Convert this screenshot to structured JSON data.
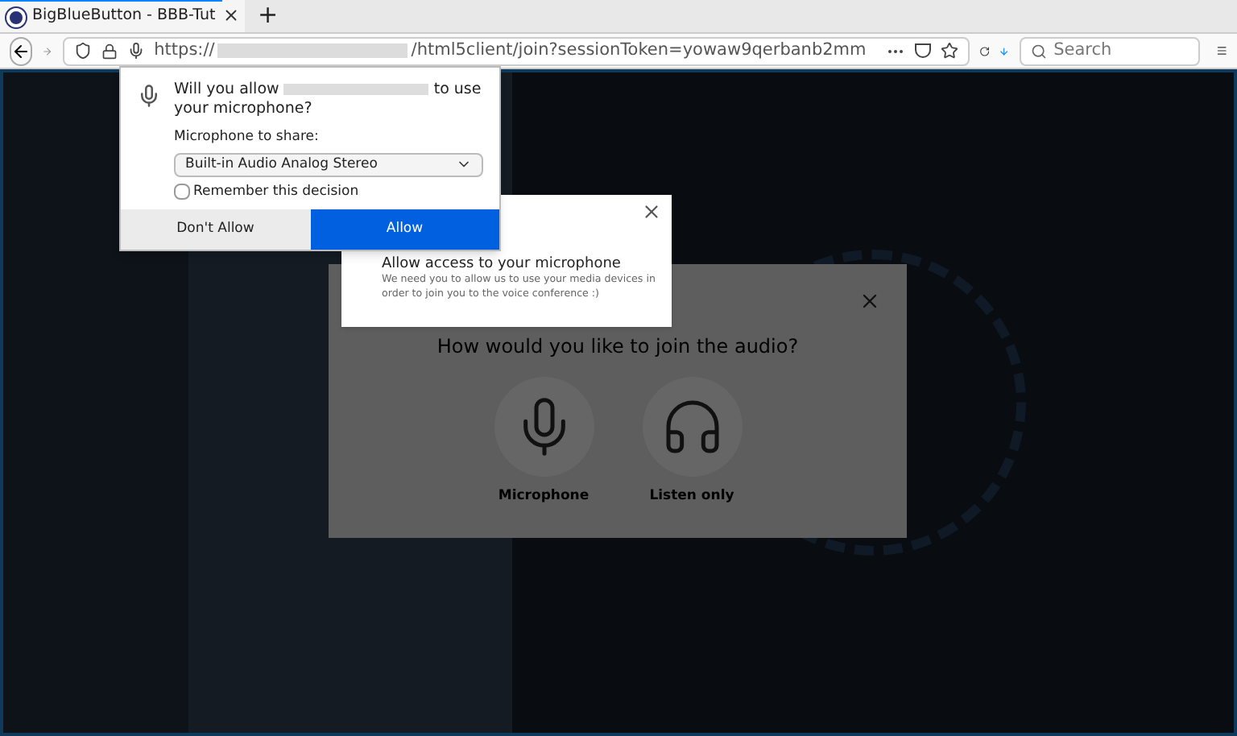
{
  "browser": {
    "tab": {
      "title": "BigBlueButton - BBB-Tut"
    },
    "new_tab": "+",
    "url": {
      "scheme": "https://",
      "path": "/html5client/join?sessionToken=yowaw9qerbanb2mm"
    },
    "search": {
      "placeholder": "Search"
    }
  },
  "permission_prompt": {
    "question_before": "Will you allow",
    "question_after": "to use your microphone?",
    "device_label": "Microphone to share:",
    "device": "Built-in Audio Analog Stereo",
    "remember": {
      "label": "Remember this decision",
      "checked": false
    },
    "buttons": [
      {
        "label": "Don't Allow",
        "kind": "secondary"
      },
      {
        "label": "Allow",
        "kind": "primary"
      }
    ]
  },
  "notification": {
    "title": "Allow access to your microphone",
    "body": "We need you to allow us to use your media devices in order to join you to the voice conference :)"
  },
  "audio_modal": {
    "title": "How would you like to join the audio?",
    "options": [
      {
        "label": "Microphone",
        "kind": "microphone"
      },
      {
        "label": "Listen only",
        "kind": "headphones"
      }
    ]
  }
}
